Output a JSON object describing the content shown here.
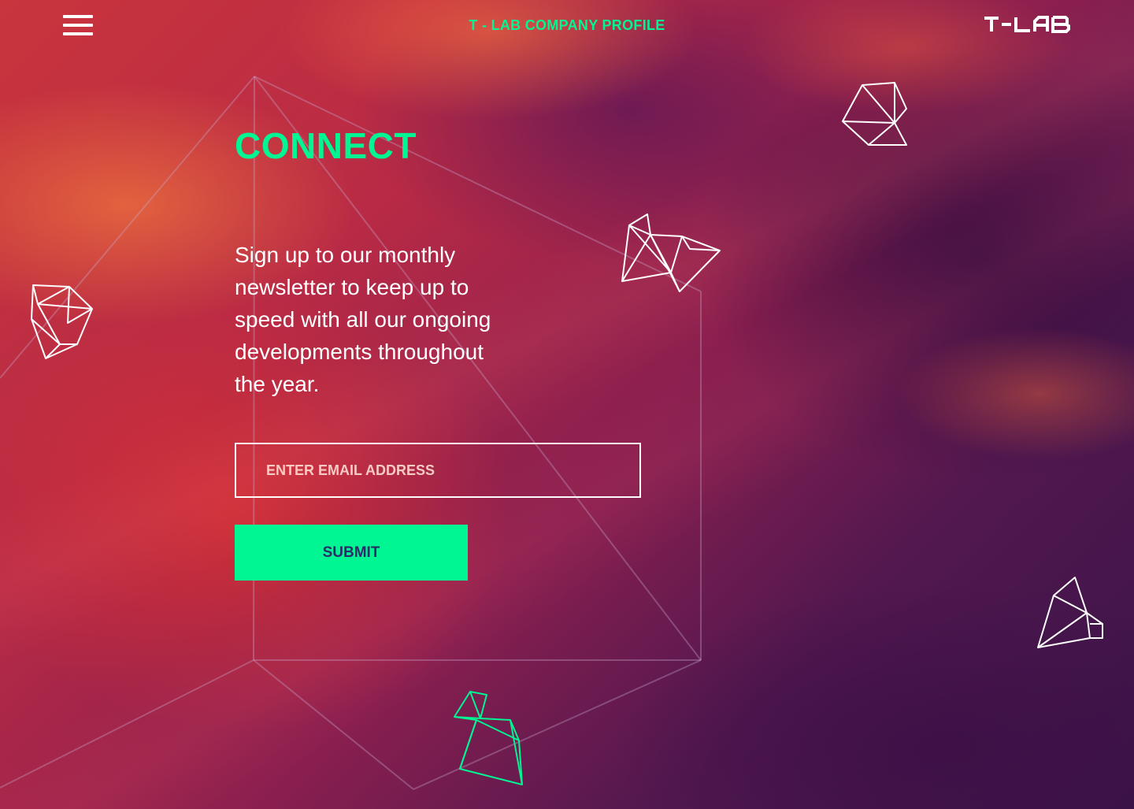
{
  "header": {
    "menu_icon": "hamburger-menu-icon",
    "title": "T - LAB COMPANY PROFILE",
    "logo_text": "T-LAB"
  },
  "main": {
    "heading": "CONNECT",
    "intro": "Sign up to our monthly newsletter to keep up to speed with all our ongoing developments throughout the year.",
    "email_placeholder": "ENTER EMAIL ADDRESS",
    "submit_label": "SUBMIT"
  },
  "colors": {
    "accent": "#00f593",
    "submit_text": "#2b2a6b",
    "text": "#ffffff"
  }
}
